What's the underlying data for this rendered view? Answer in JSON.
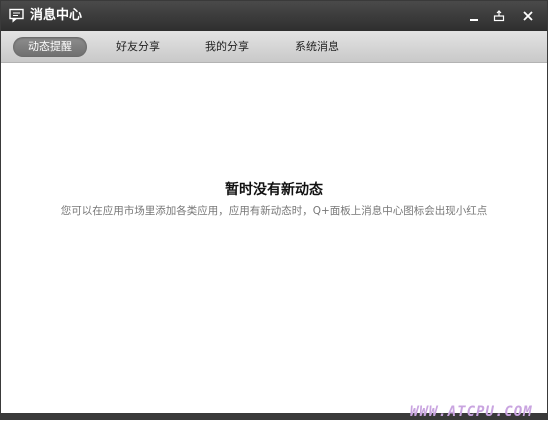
{
  "window": {
    "title": "消息中心",
    "icon": "message-icon"
  },
  "controls": {
    "minimize_icon": "minimize-icon",
    "restore_icon": "restore-icon",
    "close_icon": "close-icon"
  },
  "tabs": [
    {
      "label": "动态提醒",
      "active": true
    },
    {
      "label": "好友分享",
      "active": false
    },
    {
      "label": "我的分享",
      "active": false
    },
    {
      "label": "系统消息",
      "active": false
    }
  ],
  "empty_state": {
    "title": "暂时没有新动态",
    "description": "您可以在应用市场里添加各类应用，应用有新动态时，Q+面板上消息中心图标会出现小红点"
  },
  "watermark": "WWW.ATCPU.COM",
  "colors": {
    "titlebar": "#3a3a3a",
    "active_tab": "#7d7d7d",
    "watermark": "#c9a4e0"
  }
}
